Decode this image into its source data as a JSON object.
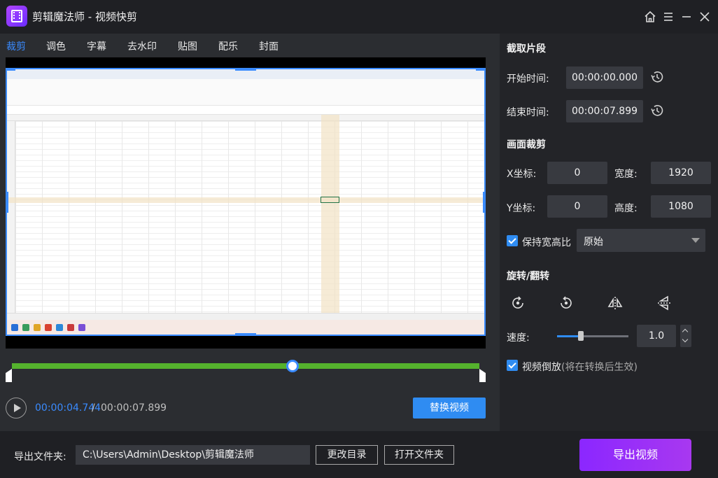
{
  "window": {
    "app_name": "剪辑魔法师",
    "title_suffix": " - 视频快剪",
    "icons": [
      "home-icon",
      "menu-icon",
      "minimize-icon",
      "close-icon"
    ]
  },
  "tabs": [
    {
      "label": "裁剪",
      "active": true
    },
    {
      "label": "调色"
    },
    {
      "label": "字幕"
    },
    {
      "label": "去水印"
    },
    {
      "label": "贴图"
    },
    {
      "label": "配乐"
    },
    {
      "label": "封面"
    }
  ],
  "player": {
    "current_time": "00:00:04.744",
    "separator": "/",
    "total_time": "00:00:07.899",
    "replace_button": "替换视频",
    "playhead_fraction": 0.6006
  },
  "clip": {
    "heading": "截取片段",
    "start_label": "开始时间:",
    "start_value": "00:00:00.000",
    "end_label": "结束时间:",
    "end_value": "00:00:07.899"
  },
  "crop": {
    "heading": "画面裁剪",
    "x_label": "X坐标:",
    "x_value": "0",
    "width_label": "宽度:",
    "width_value": "1920",
    "y_label": "Y坐标:",
    "y_value": "0",
    "height_label": "高度:",
    "height_value": "1080",
    "keep_ratio_label": "保持宽高比",
    "keep_ratio_checked": true,
    "ratio_selected": "原始"
  },
  "rotate": {
    "heading": "旋转/翻转",
    "icons": [
      "rotate-clockwise-icon",
      "rotate-counterclockwise-icon",
      "flip-horizontal-icon",
      "flip-vertical-icon"
    ]
  },
  "speed": {
    "label": "速度:",
    "value": "1.0",
    "slider_fraction": 0.33
  },
  "reverse": {
    "label": "视频倒放",
    "note": "(将在转换后生效)",
    "checked": true
  },
  "export": {
    "folder_label": "导出文件夹:",
    "path": "C:\\Users\\Admin\\Desktop\\剪辑魔法师",
    "change_dir_button": "更改目录",
    "open_folder_button": "打开文件夹",
    "export_button": "导出视频"
  },
  "colors": {
    "accent": "#2f8cf2",
    "timeline": "#55b22d",
    "export_gradient_start": "#8b27ff",
    "export_gradient_end": "#a838f0"
  }
}
